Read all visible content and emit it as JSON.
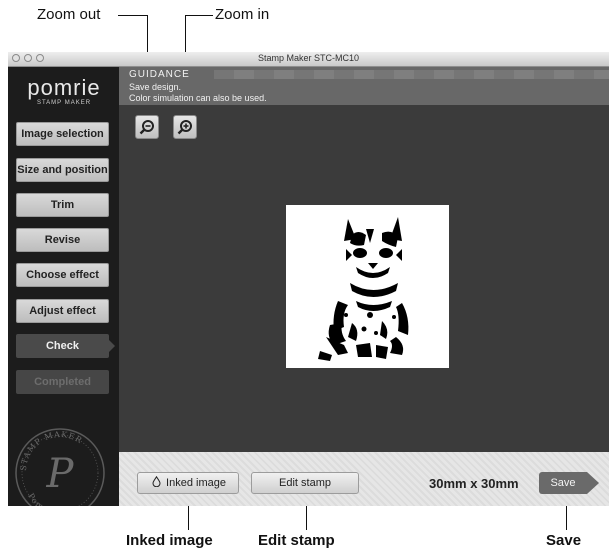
{
  "callouts": {
    "zoom_out": "Zoom out",
    "zoom_in": "Zoom in",
    "inked_image": "Inked image",
    "edit_stamp": "Edit stamp",
    "save": "Save"
  },
  "window": {
    "title": "Stamp Maker STC-MC10"
  },
  "sidebar": {
    "logo_name": "pomrie",
    "logo_sub": "STAMP MAKER",
    "items": [
      {
        "label": "Image selection",
        "state": "normal"
      },
      {
        "label": "Size and position",
        "state": "normal"
      },
      {
        "label": "Trim",
        "state": "normal"
      },
      {
        "label": "Revise",
        "state": "normal"
      },
      {
        "label": "Choose effect",
        "state": "normal"
      },
      {
        "label": "Adjust effect",
        "state": "normal"
      },
      {
        "label": "Check",
        "state": "active"
      },
      {
        "label": "Completed",
        "state": "disabled"
      }
    ],
    "seal_text_top": "STAMP MAKER",
    "seal_text_bottom": "Pomrie"
  },
  "guidance": {
    "title": "GUIDANCE",
    "line1": "Save design.",
    "line2": "Color simulation can also be used."
  },
  "toolbar": {
    "zoom_out_icon": "zoom-out-icon",
    "zoom_in_icon": "zoom-in-icon"
  },
  "preview": {
    "image": "cat-stamp-image"
  },
  "bottom": {
    "inked_image_label": "Inked image",
    "edit_stamp_label": "Edit stamp",
    "size_text": "30mm x 30mm",
    "save_label": "Save"
  }
}
